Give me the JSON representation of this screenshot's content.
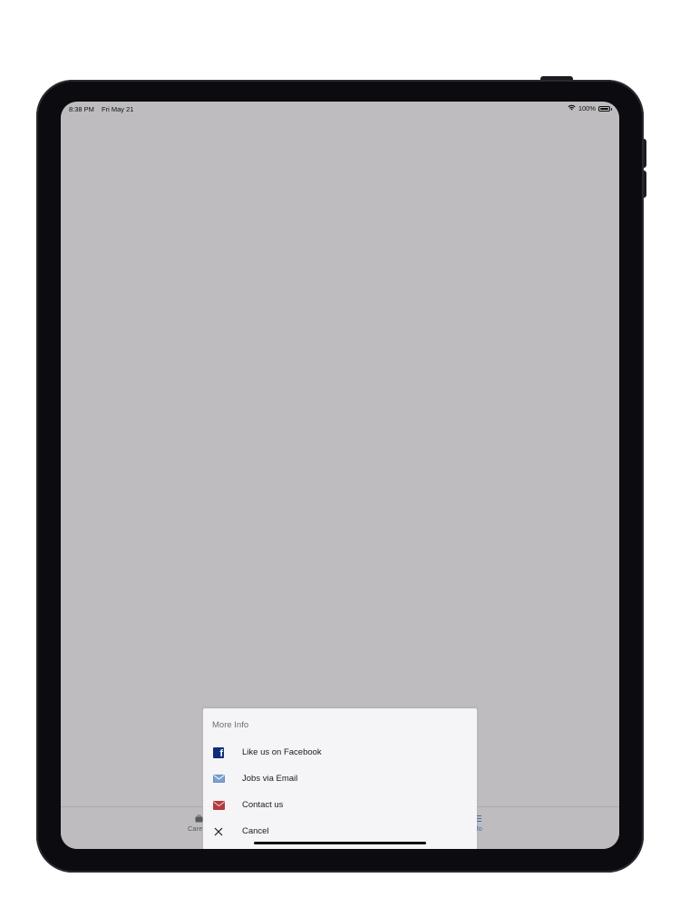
{
  "status_bar": {
    "time": "8:38 PM",
    "date": "Fri May 21",
    "battery": "100%",
    "wifi_icon": "wifi-icon",
    "battery_icon": "battery-icon"
  },
  "tab_bar": {
    "left_label": "Care",
    "right_label": "e Info"
  },
  "sheet": {
    "title": "More Info",
    "items": [
      {
        "label": "Like us on Facebook",
        "icon": "facebook-icon",
        "color": "#0d2d7a"
      },
      {
        "label": "Jobs via Email",
        "icon": "email-icon",
        "color": "#5a82b4"
      },
      {
        "label": "Contact us",
        "icon": "mail-icon",
        "color": "#b43a3e"
      },
      {
        "label": "Cancel",
        "icon": "close-icon",
        "color": "#1d1d1f"
      }
    ]
  },
  "colors": {
    "screen_dim": "#bebcbf",
    "sheet_bg": "#f5f4f7",
    "tab_active": "#4a6fa5"
  }
}
